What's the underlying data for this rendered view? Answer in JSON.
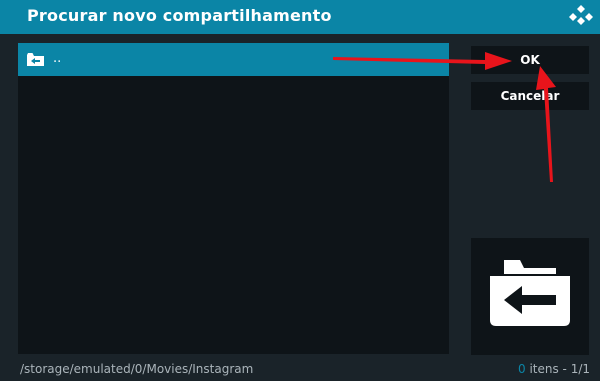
{
  "dialog": {
    "title": "Procurar novo compartilhamento",
    "logo_icon": "kodi-logo-icon"
  },
  "file_list": {
    "items": [
      {
        "label": "..",
        "icon": "folder-back-icon",
        "selected": true
      }
    ]
  },
  "buttons": {
    "ok_label": "OK",
    "cancel_label": "Cancelar"
  },
  "preview": {
    "icon": "folder-back-icon"
  },
  "status": {
    "path": "/storage/emulated/0/Movies/Instagram",
    "item_count": "0",
    "items_text": " itens - ",
    "page": "1/1"
  },
  "colors": {
    "accent": "#0b85a6",
    "background": "#1a2329",
    "panel": "#0e1418",
    "annotation_arrow": "#e8141b"
  }
}
